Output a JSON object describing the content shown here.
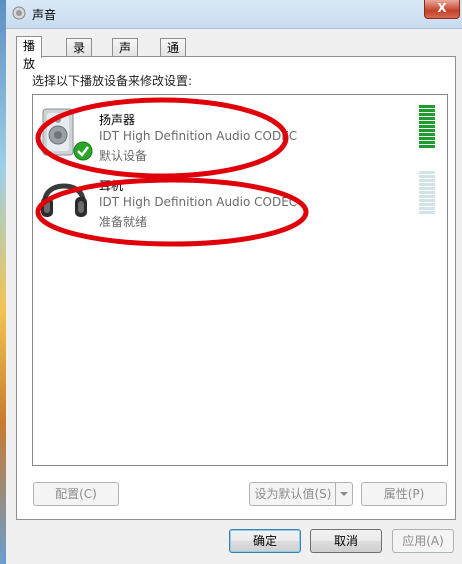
{
  "window": {
    "title": "声音",
    "close_label": "X"
  },
  "tabs": [
    {
      "label": "播放",
      "active": true
    },
    {
      "label": "录制",
      "active": false
    },
    {
      "label": "声音",
      "active": false
    },
    {
      "label": "通信",
      "active": false
    }
  ],
  "instruction": "选择以下播放设备来修改设置:",
  "devices": [
    {
      "name": "扬声器",
      "description": "IDT High Definition Audio CODEC",
      "status": "默认设备",
      "icon": "speaker-icon",
      "badge": "default-check-icon",
      "meter_level": 1.0
    },
    {
      "name": "耳机",
      "description": "IDT High Definition Audio CODEC",
      "status": "准备就绪",
      "icon": "headphones-icon",
      "meter_level": 0.0
    }
  ],
  "buttons": {
    "configure": "配置(C)",
    "set_default": "设为默认值(S)",
    "properties": "属性(P)",
    "ok": "确定",
    "cancel": "取消",
    "apply": "应用(A)"
  },
  "colors": {
    "meter_active": "#1e9c2e",
    "meter_inactive": "#d3e3ea",
    "annotation": "#e0000a"
  }
}
